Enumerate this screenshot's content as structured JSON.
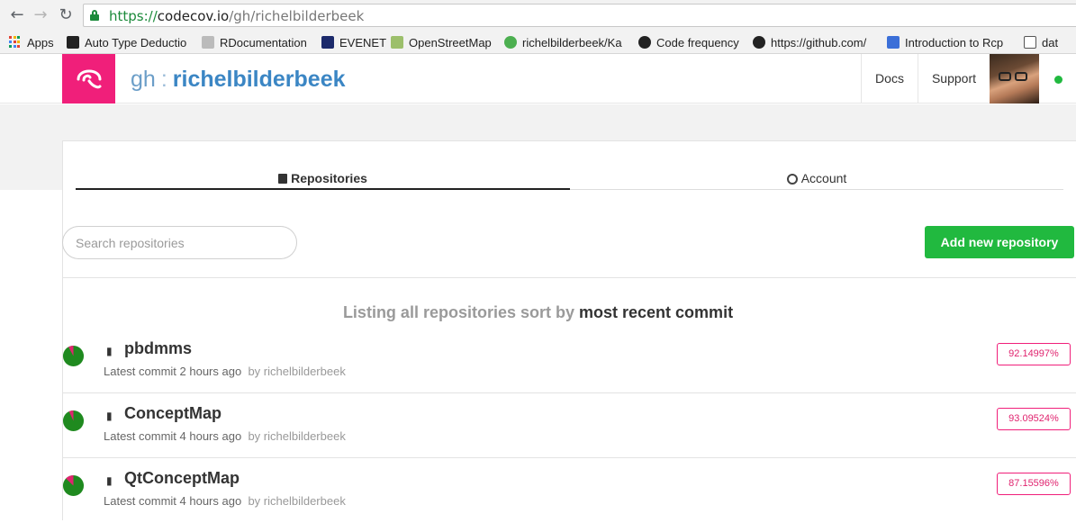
{
  "browser": {
    "url": {
      "scheme": "https://",
      "host": "codecov.io",
      "path": "/gh/richelbilderbeek"
    },
    "bookmarks": [
      {
        "label": "Apps",
        "icon": "apps-grid-icon"
      },
      {
        "label": "Auto Type Deductio",
        "icon": "page-icon"
      },
      {
        "label": "RDocumentation",
        "icon": "rdoc-icon"
      },
      {
        "label": "EVENET",
        "icon": "building-icon"
      },
      {
        "label": "OpenStreetMap",
        "icon": "map-icon"
      },
      {
        "label": "richelbilderbeek/Ka",
        "icon": "github-icon"
      },
      {
        "label": "Code frequency",
        "icon": "github-icon"
      },
      {
        "label": "https://github.com/",
        "icon": "github-icon"
      },
      {
        "label": "Introduction to Rcp",
        "icon": "cube-icon"
      },
      {
        "label": "dat",
        "icon": "file-icon"
      }
    ]
  },
  "header": {
    "service": "gh",
    "separator": ":",
    "owner": "richelbilderbeek",
    "docs": "Docs",
    "support": "Support",
    "status_color": "#21b93f"
  },
  "tabs": {
    "repositories": "Repositories",
    "account": "Account"
  },
  "search": {
    "placeholder": "Search repositories"
  },
  "add_button": "Add new repository",
  "listing": {
    "prefix": "Listing all repositories sort by",
    "sort": "most recent commit"
  },
  "repos": [
    {
      "name": "pbdmms",
      "commit": "Latest commit 2 hours ago",
      "by": "by richelbilderbeek",
      "coverage": "92.14997%",
      "coverage_value": 92.14997
    },
    {
      "name": "ConceptMap",
      "commit": "Latest commit 4 hours ago",
      "by": "by richelbilderbeek",
      "coverage": "93.09524%",
      "coverage_value": 93.09524
    },
    {
      "name": "QtConceptMap",
      "commit": "Latest commit 4 hours ago",
      "by": "by richelbilderbeek",
      "coverage": "87.15596%",
      "coverage_value": 87.15596
    }
  ],
  "colors": {
    "brand": "#f01f7a",
    "green": "#21b93f",
    "link_blue": "#3b86c4"
  }
}
